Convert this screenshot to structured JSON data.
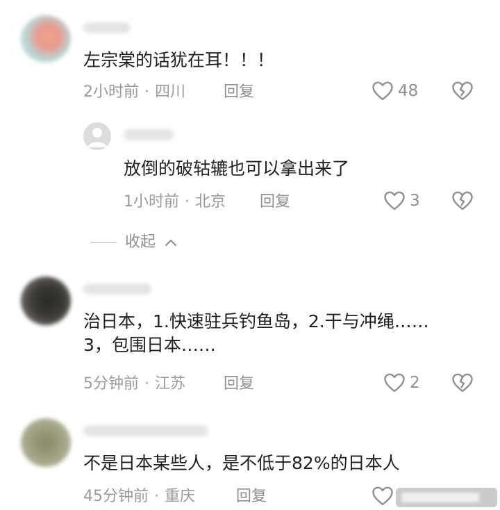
{
  "comments": [
    {
      "text": "左宗棠的话犹在耳！！！",
      "time": "2小时前",
      "location": "四川",
      "reply_label": "回复",
      "likes": "48"
    },
    {
      "text": "放倒的破轱辘也可以拿出来了",
      "time": "1小时前",
      "location": "北京",
      "reply_label": "回复",
      "likes": "3"
    },
    {
      "text": "治日本，1.快速驻兵钓鱼岛，2.干与冲绳……3，包围日本……",
      "time": "5分钟前",
      "location": "江苏",
      "reply_label": "回复",
      "likes": "2"
    },
    {
      "text": "不是日本某些人，是不低于82%的日本人",
      "time": "45分钟前",
      "location": "重庆",
      "reply_label": "回复"
    }
  ],
  "collapse_label": "收起",
  "separator": "·",
  "icons": {
    "like": "heart-outline-icon",
    "dislike": "broken-heart-icon",
    "collapse": "chevron-up-icon"
  },
  "colors": {
    "text": "#1f1f1f",
    "meta": "#9a9a9a",
    "icon": "#8f8f8f"
  }
}
